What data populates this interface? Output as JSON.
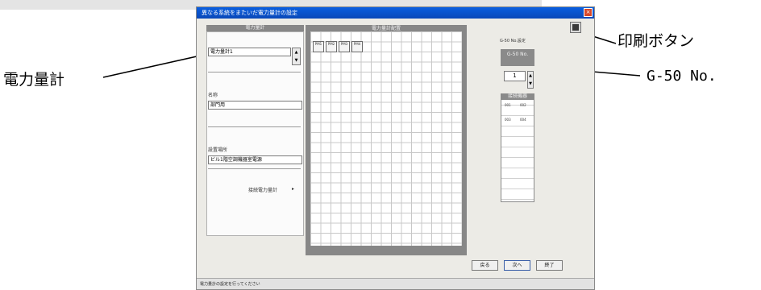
{
  "callouts": {
    "power_meter": "電力量計",
    "print_button": "印刷ボタン",
    "g50_no": "G-50 No."
  },
  "window": {
    "title": "異なる系統をまたいだ電力量計の設定",
    "close_glyph": "×",
    "left_panel": {
      "header": "電力量計",
      "meter_select_value": "電力量計1",
      "name_label": "名称",
      "name_value": "部門用",
      "location_label": "設置場所",
      "location_value": "ビル1階空調機器室電源",
      "link_label": "接続電力量計",
      "link_arrow": "▸"
    },
    "grid": {
      "header": "電力量計配置",
      "meter_icons": [
        "PM1",
        "PM2",
        "PM3",
        "PM4"
      ]
    },
    "right_panel": {
      "g50_caption": "G-50 No.設定",
      "g50_header": "G-50 No.",
      "g50_value": "1",
      "list_header": "接続機器",
      "list_rows": [
        [
          "001",
          "002"
        ],
        [
          "003",
          "004"
        ]
      ]
    },
    "buttons": {
      "prev": "戻る",
      "next": "次へ",
      "finish": "終了"
    },
    "status_text": "電力量計の設定を行ってください"
  }
}
